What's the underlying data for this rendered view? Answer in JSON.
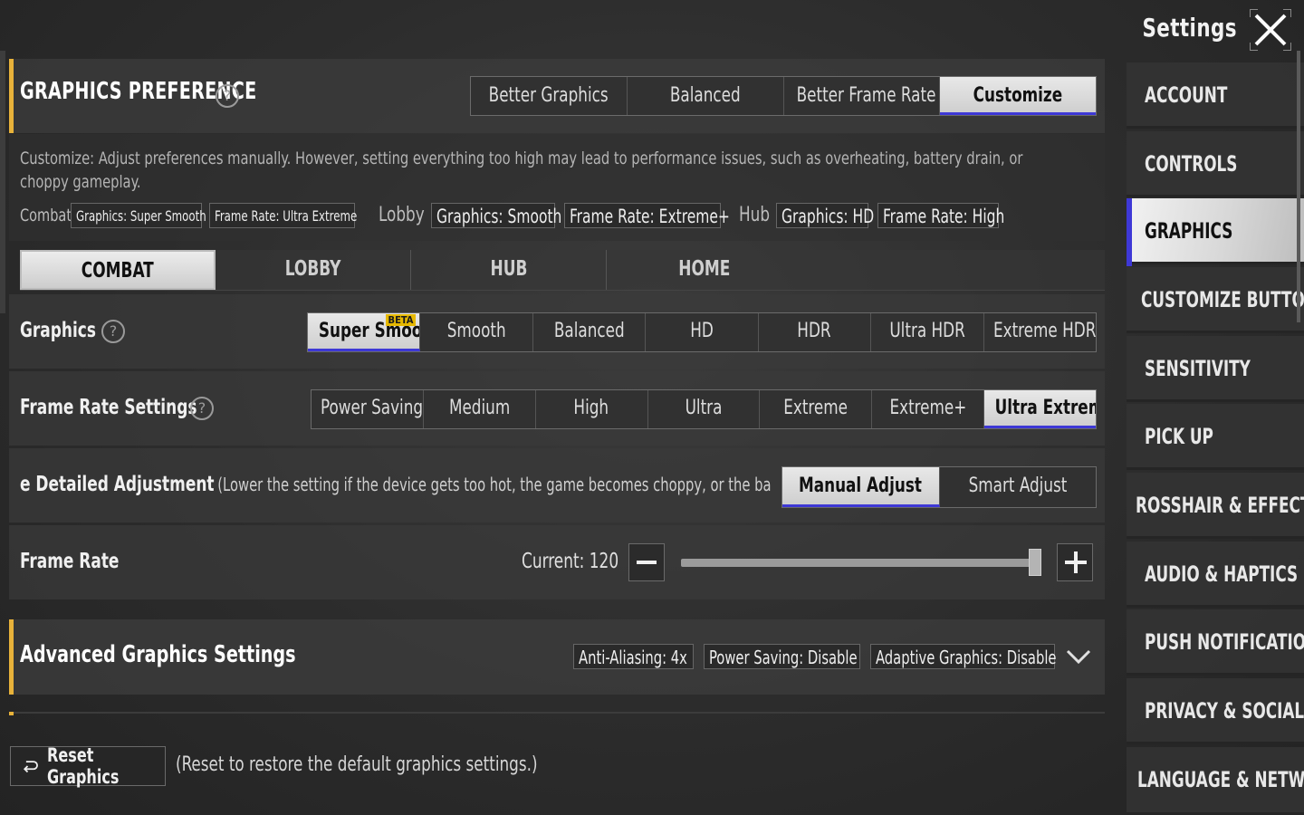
{
  "header": {
    "title": "Settings",
    "close_icon": "close-icon"
  },
  "graphics_preference": {
    "title": "GRAPHICS PREFERENCE",
    "options": [
      "Better Graphics",
      "Balanced",
      "Better Frame Rate",
      "Customize"
    ],
    "selected": "Customize",
    "description": "Customize: Adjust preferences manually. However, setting everything too high may lead to performance issues, such as overheating, battery drain, or choppy gameplay.",
    "summary": {
      "combat_label": "Combat",
      "combat_graphics": "Graphics: Super Smooth",
      "combat_framerate": "Frame Rate: Ultra Extreme",
      "lobby_label": "Lobby",
      "lobby_graphics": "Graphics: Smooth",
      "lobby_framerate": "Frame Rate: Extreme+",
      "hub_label": "Hub",
      "hub_graphics": "Graphics: HD",
      "hub_framerate": "Frame Rate: High"
    }
  },
  "mode_tabs": {
    "items": [
      "COMBAT",
      "LOBBY",
      "HUB",
      "HOME"
    ],
    "selected": "COMBAT"
  },
  "graphics": {
    "label": "Graphics",
    "options": [
      "Super Smooth",
      "Smooth",
      "Balanced",
      "HD",
      "HDR",
      "Ultra HDR",
      "Extreme HDR"
    ],
    "selected": "Super Smooth",
    "badge": "BETA"
  },
  "frame_rate_settings": {
    "label": "Frame Rate Settings",
    "options": [
      "Power Saving",
      "Medium",
      "High",
      "Ultra",
      "Extreme",
      "Extreme+",
      "Ultra Extreme"
    ],
    "selected": "Ultra Extreme"
  },
  "detailed_adjustment": {
    "label": "e Detailed Adjustment",
    "note": "(Lower the setting if the device gets too hot, the game becomes choppy, or the battery dr",
    "options": [
      "Manual Adjust",
      "Smart Adjust"
    ],
    "selected": "Manual Adjust"
  },
  "frame_rate": {
    "label": "Frame Rate",
    "current_text": "Current: 120",
    "level": 0.98
  },
  "advanced": {
    "title": "Advanced Graphics Settings",
    "tags": [
      "Anti-Aliasing: 4x",
      "Power Saving: Disable",
      "Adaptive Graphics: Disable"
    ],
    "expand_icon": "chevron-down-icon"
  },
  "reset": {
    "button_label": "Reset Graphics",
    "note": "(Reset to restore the default graphics settings.)"
  },
  "sidebar": {
    "items": [
      {
        "label": "ACCOUNT"
      },
      {
        "label": "CONTROLS"
      },
      {
        "label": "GRAPHICS"
      },
      {
        "label": "CUSTOMIZE BUTTON"
      },
      {
        "label": "SENSITIVITY"
      },
      {
        "label": "PICK UP"
      },
      {
        "label": "ROSSHAIR & EFFECTS"
      },
      {
        "label": "AUDIO & HAPTICS"
      },
      {
        "label": "PUSH NOTIFICATION"
      },
      {
        "label": "PRIVACY & SOCIAL"
      },
      {
        "label": "LANGUAGE & NETWORK"
      }
    ],
    "selected": "GRAPHICS"
  },
  "colors": {
    "accent_yellow": "#e8b23a",
    "accent_blue": "#3e38d6",
    "selected_bg": "#d8d8d8"
  }
}
